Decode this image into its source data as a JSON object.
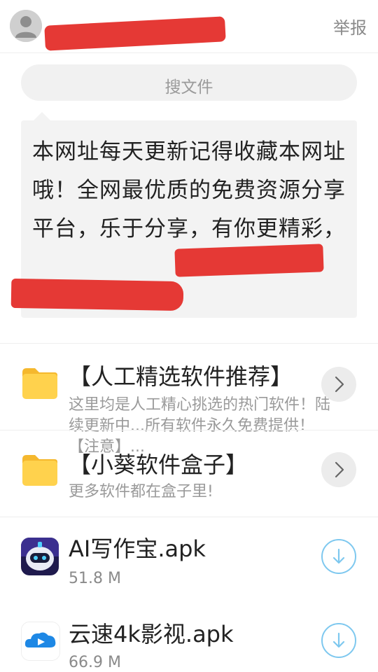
{
  "header": {
    "report_label": "举报"
  },
  "search": {
    "placeholder": "搜文件"
  },
  "notice": {
    "text": "本网址每天更新记得收藏本网址哦！全网最优质的免费资源分享平台，乐于分享，有你更精彩，"
  },
  "files": [
    {
      "name": "【人工精选软件推荐】",
      "desc": "这里均是人工精心挑选的热门软件！陆续更新中...所有软件永久免费提供！【注意】..."
    },
    {
      "name": "【小葵软件盒子】",
      "desc": "更多软件都在盒子里!"
    },
    {
      "name": "AI写作宝.apk",
      "size": "51.8 M"
    },
    {
      "name": "云速4k影视.apk",
      "size": "66.9 M"
    }
  ],
  "colors": {
    "folder": "#FFD24D",
    "download_ring": "#7EC8EF",
    "redaction": "#E53935"
  }
}
